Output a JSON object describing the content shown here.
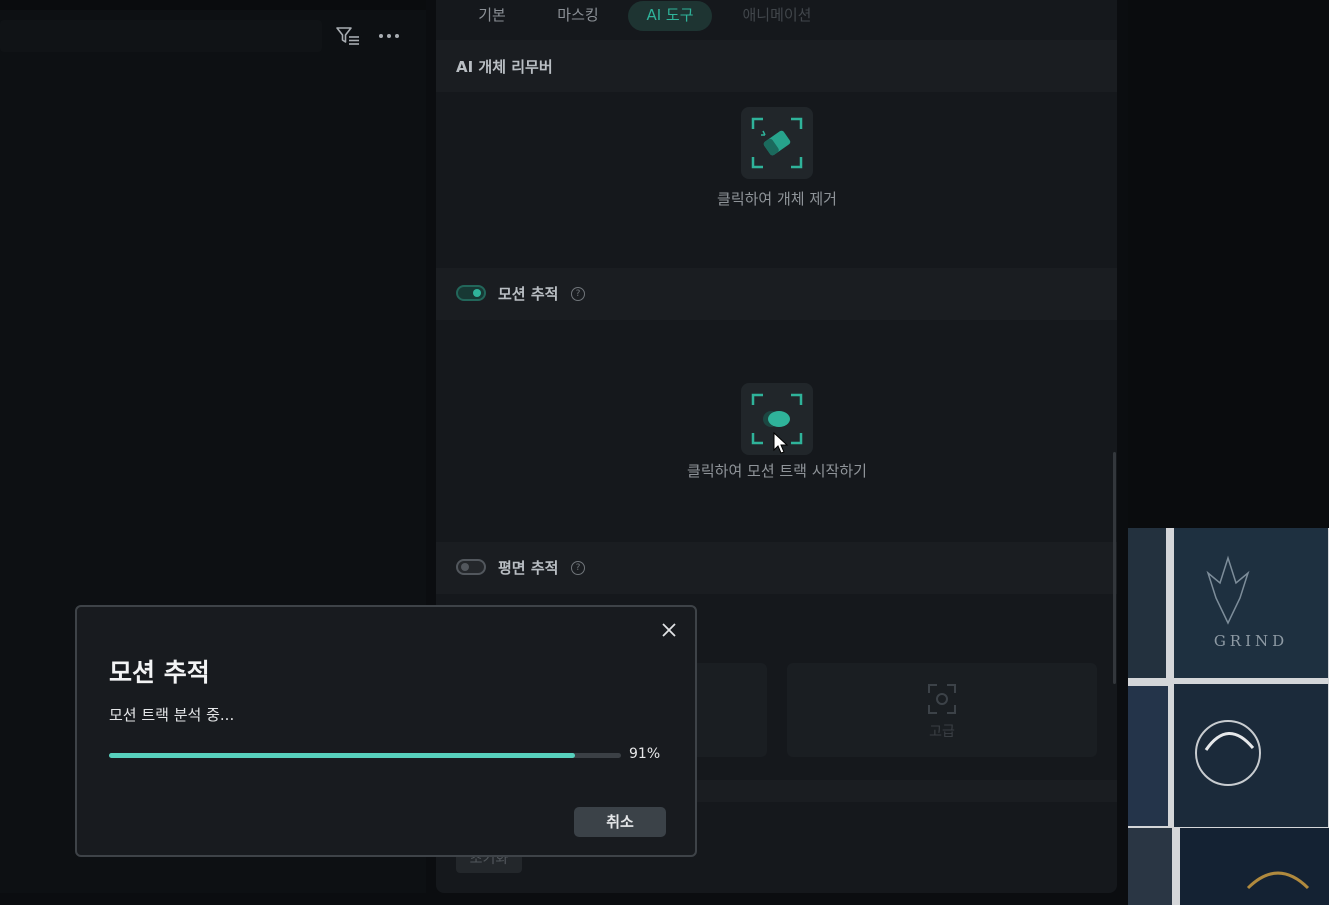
{
  "tabs": [
    {
      "label": "기본",
      "state": "normal"
    },
    {
      "label": "마스킹",
      "state": "normal"
    },
    {
      "label": "AI 도구",
      "state": "active"
    },
    {
      "label": "애니메이션",
      "state": "disabled"
    }
  ],
  "ai_remover": {
    "title": "AI 개체 리무버",
    "button_caption": "클릭하여 개체 제거",
    "icon": "eraser-frame-icon"
  },
  "motion_tracking": {
    "label": "모션 추적",
    "enabled": true,
    "button_caption": "클릭하여 모션 트랙 시작하기",
    "icon": "motion-track-icon"
  },
  "planar_tracking": {
    "label": "평면 추적",
    "enabled": false
  },
  "bottom": {
    "card_label": "고급",
    "chip_label": "초기화"
  },
  "dialog": {
    "title": "모션 추적",
    "status": "모션 트랙 분석 중...",
    "progress_value": 0.91,
    "progress_label": "91%",
    "cancel_label": "취소"
  },
  "colors": {
    "accent": "#2fb39a",
    "progress": "#57d1bd",
    "panel": "#15181c",
    "dialog_bg": "#181b1f"
  }
}
